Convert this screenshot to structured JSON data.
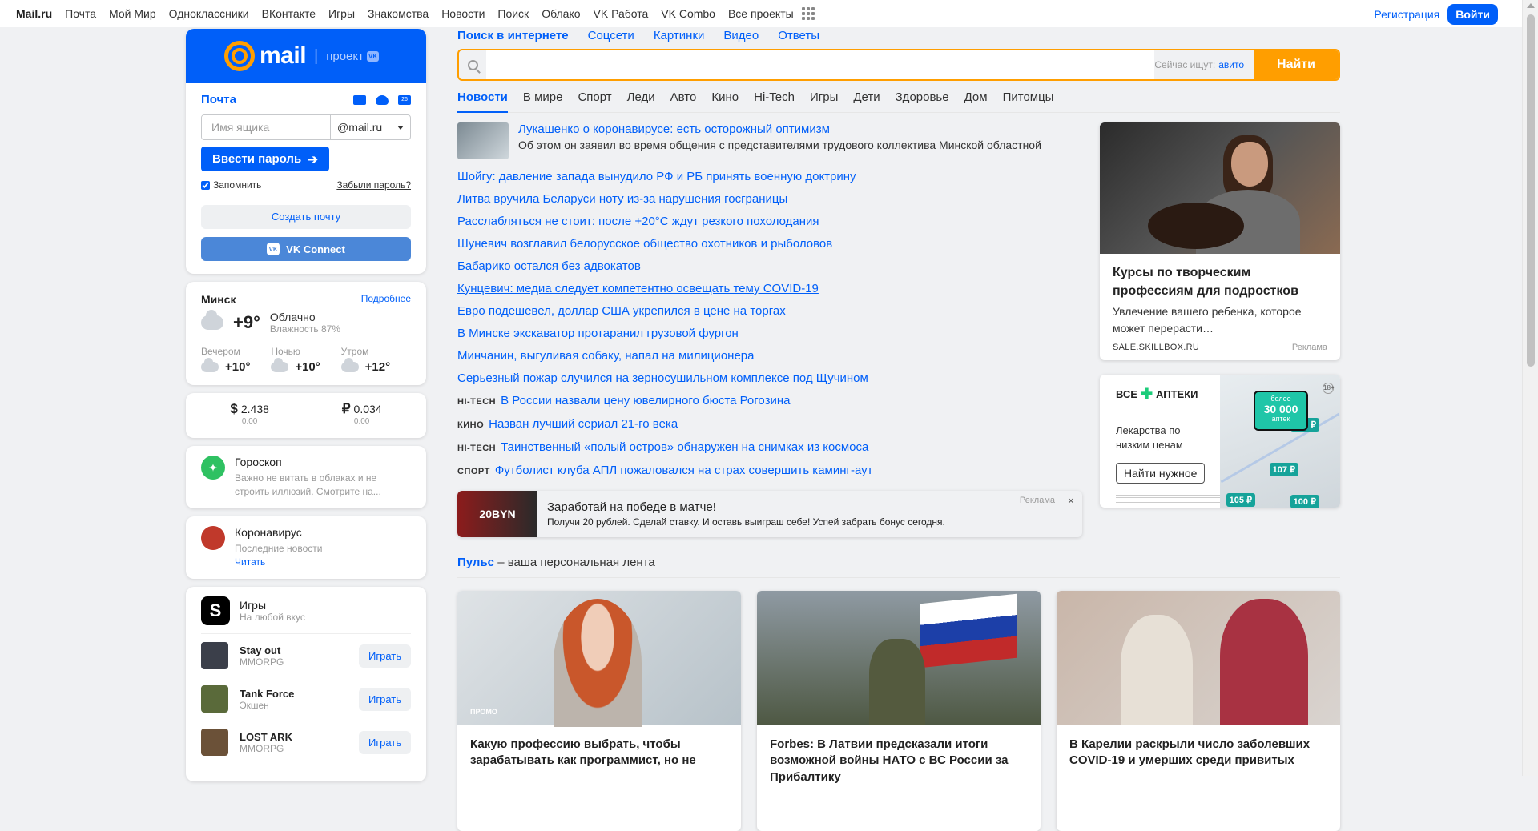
{
  "topbar": {
    "logo": "Mail.ru",
    "links": [
      "Почта",
      "Мой Мир",
      "Одноклассники",
      "ВКонтакте",
      "Игры",
      "Знакомства",
      "Новости",
      "Поиск",
      "Облако",
      "VK Работа",
      "VK Combo",
      "Все проекты"
    ],
    "register": "Регистрация",
    "login": "Войти"
  },
  "mail": {
    "brand": "mail",
    "project": "проект",
    "project_badge": "VK",
    "title": "Почта",
    "calendar_day": "26",
    "mailbox_placeholder": "Имя ящика",
    "domain": "@mail.ru",
    "password_button": "Ввести пароль",
    "remember": "Запомнить",
    "forgot": "Забыли пароль?",
    "create": "Создать почту",
    "vk_connect": "VK Connect",
    "vk_logo": "VK"
  },
  "weather": {
    "city": "Минск",
    "more": "Подробнее",
    "temp": "+9°",
    "desc": "Облачно",
    "humidity": "Влажность 87%",
    "forecast": [
      {
        "label": "Вечером",
        "temp": "+10°"
      },
      {
        "label": "Ночью",
        "temp": "+10°"
      },
      {
        "label": "Утром",
        "temp": "+12°"
      }
    ]
  },
  "currency": [
    {
      "symbol": "$",
      "value": "2.438",
      "change": "0.00"
    },
    {
      "symbol": "₽",
      "value": "0.034",
      "change": "0.00"
    }
  ],
  "horoscope": {
    "title": "Гороскоп",
    "text": "Важно не витать в облаках и не строить иллюзий. Смотрите на..."
  },
  "covid": {
    "title": "Коронавирус",
    "text": "Последние новости",
    "link": "Читать"
  },
  "games": {
    "logo_letter": "S",
    "title": "Игры",
    "subtitle": "На любой вкус",
    "play_label": "Играть",
    "items": [
      {
        "name": "Stay out",
        "genre": "MMORPG",
        "color": "#3b3f4a"
      },
      {
        "name": "Tank Force",
        "genre": "Экшен",
        "color": "#5a6a3a"
      },
      {
        "name": "LOST ARK",
        "genre": "MMORPG",
        "color": "#6b5138"
      }
    ]
  },
  "search": {
    "tabs": [
      "Поиск в интернете",
      "Соцсети",
      "Картинки",
      "Видео",
      "Ответы"
    ],
    "hint_label": "Сейчас ищут:",
    "hint_link": "авито",
    "button": "Найти"
  },
  "news": {
    "tabs": [
      "Новости",
      "В мире",
      "Спорт",
      "Леди",
      "Авто",
      "Кино",
      "Hi-Tech",
      "Игры",
      "Дети",
      "Здоровье",
      "Дом",
      "Питомцы"
    ],
    "lead": {
      "title": "Лукашенко о коронавирусе: есть осторожный оптимизм",
      "desc": "Об этом он заявил во время общения с представителями трудового коллектива Минской областной"
    },
    "items": [
      {
        "cat": "",
        "text": "Шойгу: давление запада вынудило РФ и РБ принять военную доктрину"
      },
      {
        "cat": "",
        "text": "Литва вручила Беларуси ноту из-за нарушения госграницы"
      },
      {
        "cat": "",
        "text": "Расслабляться не стоит: после +20°C ждут резкого похолодания"
      },
      {
        "cat": "",
        "text": "Шуневич возглавил белорусское общество охотников и рыболовов"
      },
      {
        "cat": "",
        "text": "Бабарико остался без адвокатов"
      },
      {
        "cat": "",
        "text": "Кунцевич: медиа следует компетентно освещать тему COVID-19"
      },
      {
        "cat": "",
        "text": "Евро подешевел, доллар США укрепился в цене на торгах"
      },
      {
        "cat": "",
        "text": "В Минске экскаватор протаранил грузовой фургон"
      },
      {
        "cat": "",
        "text": "Минчанин, выгуливая собаку, напал на милиционера"
      },
      {
        "cat": "",
        "text": "Серьезный пожар случился на зерносушильном комплексе под Щучином"
      },
      {
        "cat": "Hi-Tech",
        "text": "В России назвали цену ювелирного бюста Рогозина"
      },
      {
        "cat": "Кино",
        "text": "Назван лучший сериал 21-го века"
      },
      {
        "cat": "Hi-Tech",
        "text": "Таинственный «полый остров» обнаружен на снимках из космоса"
      },
      {
        "cat": "Спорт",
        "text": "Футболист клуба АПЛ пожаловался на страх совершить каминг-аут"
      }
    ]
  },
  "ad_strip": {
    "image_text": "20BYN",
    "title": "Заработай на победе в матче!",
    "desc": "Получи 20 рублей. Сделай ставку. И оставь выиграш себе! Успей забрать бонус сегодня.",
    "label": "Реклама",
    "close": "×"
  },
  "ad_card": {
    "title": "Курсы по творческим профессиям для подростков",
    "desc": "Увлечение вашего ребенка, которое может перерасти…",
    "domain": "SALE.SKILLBOX.RU",
    "label": "Реклама"
  },
  "pharmacy": {
    "logo_left": "ВСЕ",
    "logo_right": "АПТЕКИ",
    "text": "Лекарства по низким ценам",
    "button": "Найти нужное",
    "big_top": "более",
    "big_num": "30 000",
    "big_bottom": "аптек",
    "age": "18+",
    "prices": [
      "100 ₽",
      "107 ₽",
      "105 ₽",
      "100 ₽"
    ]
  },
  "pulse": {
    "brand": "Пульс",
    "tagline": " – ваша персональная лента",
    "cards": [
      {
        "title": "Какую профессию выбрать, чтобы зарабатывать как программист, но не",
        "promo": "ПРОМО"
      },
      {
        "title": "Forbes: В Латвии предсказали итоги возможной войны НАТО с ВС России за Прибалтику",
        "promo": ""
      },
      {
        "title": "В Карелии раскрыли число заболевших COVID-19 и умерших среди привитых",
        "promo": ""
      }
    ]
  }
}
